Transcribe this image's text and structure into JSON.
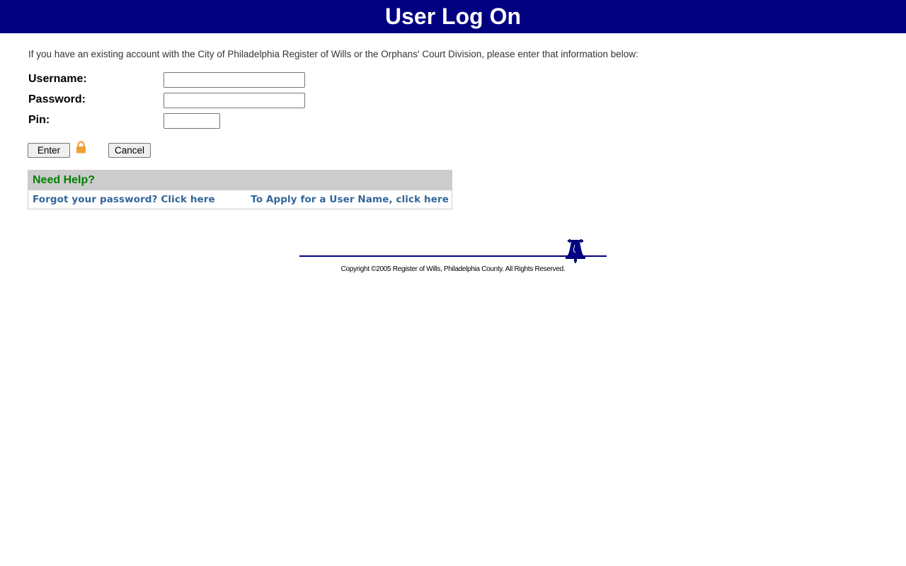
{
  "header": {
    "title": "User Log On",
    "background_color": "#000080"
  },
  "intro_text": "If you have an existing account with the City of Philadelphia Register of Wills or the Orphans' Court Division, please enter that information below:",
  "form": {
    "username_label": "Username:",
    "username_value": "",
    "password_label": "Password:",
    "password_value": "",
    "pin_label": "Pin:",
    "pin_value": "",
    "enter_label": "Enter",
    "cancel_label": "Cancel",
    "lock_icon": "lock-icon",
    "lock_color": "#f0a030"
  },
  "help": {
    "heading": "Need Help?",
    "heading_color": "#008000",
    "forgot_password_link": "Forgot your password? Click here",
    "apply_username_link": "To Apply for a User Name, click here",
    "link_color": "#336699"
  },
  "footer": {
    "copyright": "Copyright ©2005 Register of Wills, Philadelphia County. All Rights Reserved.",
    "emblem_icon": "liberty-bell-icon",
    "line_color": "#000080"
  }
}
